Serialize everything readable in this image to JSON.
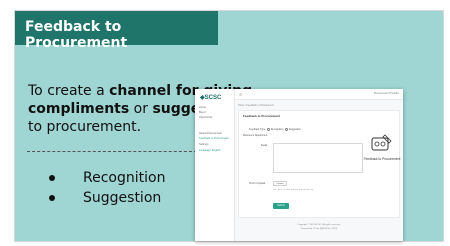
{
  "slide": {
    "title": "Feedback to Procurement",
    "intro_pre": "To create a ",
    "intro_bold1": "channel for giving compliments",
    "intro_mid": " or ",
    "intro_bold2": "suggestions",
    "intro_post": " to procurement.",
    "bullets": [
      "Recognition",
      "Suggestion"
    ]
  },
  "screenshot": {
    "logo": "SCSC",
    "nav": [
      "Home",
      "Buyer",
      "Opportunity",
      "Award Procurement",
      "Feedback to Procurement",
      "Settings",
      "Language: English"
    ],
    "user": "Procurement Provider",
    "breadcrumb": "Home / Feedback to Procurement",
    "card_title": "Feedback to Procurement",
    "feedback_type_label": "Feedback Type",
    "option_recognition": "Recognition",
    "option_suggestion": "Suggestion",
    "reference_label": "Reference Department",
    "detail_label": "Detail",
    "upload_label": "Proof of upload",
    "upload_button": "Upload",
    "upload_hint": ".doc .docx .xls .xlsx .pdf .jpg .png .gif .ppt .zip",
    "submit": "Submit",
    "feedback_label": "Feedback to Procurement",
    "footer1": "Copyright © 2023 SCSC. All rights reserved.",
    "footer2": "Powered by IT Unit (BEKSI No. 1879)"
  },
  "colors": {
    "title_bar": "#1f7569",
    "background": "#9fd5d3",
    "accent": "#2aa18a"
  }
}
